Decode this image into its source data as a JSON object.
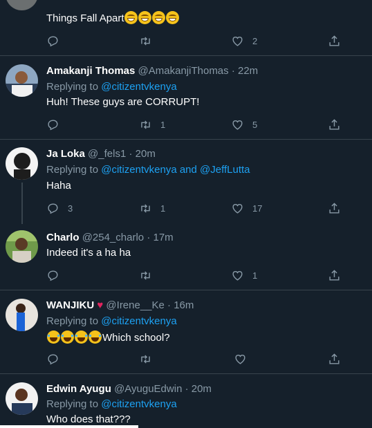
{
  "tweets": [
    {
      "text": "Things Fall Apart",
      "emoji_count": 4,
      "emoji": "grin",
      "reply_count": "",
      "retweet_count": "",
      "like_count": "2"
    },
    {
      "name": "Amakanji Thomas",
      "handle": "@AmakanjiThomas",
      "time": "· 22m",
      "replying_to": "Replying to",
      "mention": "@citizentvkenya",
      "text": "Huh! These guys are CORRUPT!",
      "reply_count": "",
      "retweet_count": "1",
      "like_count": "5"
    },
    {
      "name": "Ja Loka",
      "handle": "@_fels1",
      "time": "· 20m",
      "replying_to": "Replying to",
      "mention": "@citizentvkenya and @JeffLutta",
      "text": "Haha",
      "reply_count": "3",
      "retweet_count": "1",
      "like_count": "17"
    },
    {
      "name": "Charlo",
      "handle": "@254_charlo",
      "time": "· 17m",
      "text": "Indeed it's a ha ha",
      "reply_count": "",
      "retweet_count": "",
      "like_count": "1"
    },
    {
      "name": "WANJIKU",
      "name_emoji": "♥",
      "handle": "@Irene__Ke",
      "time": "· 16m",
      "replying_to": "Replying to",
      "mention": "@citizentvkenya",
      "text": "Which school?",
      "emoji_count": 4,
      "emoji": "joy",
      "reply_count": "",
      "retweet_count": "",
      "like_count": ""
    },
    {
      "name": "Edwin Ayugu",
      "handle": "@AyuguEdwin",
      "time": "· 20m",
      "replying_to": "Replying to",
      "mention": "@citizentvkenya",
      "text": "Who does that???"
    }
  ],
  "colors": {
    "background": "#15202b",
    "border": "#38444d",
    "muted": "#8899a6",
    "link": "#1da1f2",
    "heart": "#e0245e"
  },
  "icons": [
    "reply-icon",
    "retweet-icon",
    "like-icon",
    "share-icon"
  ]
}
